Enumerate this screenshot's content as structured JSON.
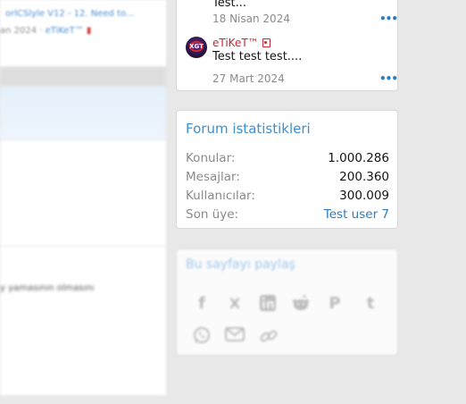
{
  "left": {
    "thread_link": "orlCSlyle V12 - 12. Need to...",
    "thread_meta_date": "an 2024 · ",
    "thread_meta_user": "eTiKeT™",
    "snippet": "y yamasının olmasını"
  },
  "latest_messages": {
    "items": [
      {
        "text": "Test...",
        "date": "18 Nisan 2024",
        "more": "•••"
      },
      {
        "username": "eTiKeT™",
        "text": "Test test test....",
        "date": "27 Mart 2024",
        "more": "•••",
        "avatar_text": "XGT"
      }
    ]
  },
  "stats": {
    "title": "Forum istatistikleri",
    "rows": [
      {
        "label": "Konular:",
        "value": "1.000.286"
      },
      {
        "label": "Mesajlar:",
        "value": "200.360"
      },
      {
        "label": "Kullanıcılar:",
        "value": "300.009"
      },
      {
        "label": "Son üye:",
        "value": "Test user 7"
      }
    ]
  },
  "share": {
    "title": "Bu sayfayı paylaş",
    "icons": [
      "facebook-icon",
      "x-icon",
      "linkedin-icon",
      "reddit-icon",
      "pinterest-icon",
      "tumblr-icon",
      "whatsapp-icon",
      "email-icon",
      "link-icon"
    ]
  },
  "colors": {
    "accent": "#3a8fcf",
    "link": "#2f7bbf",
    "username": "#c8282e",
    "background": "#e8e8e8"
  }
}
